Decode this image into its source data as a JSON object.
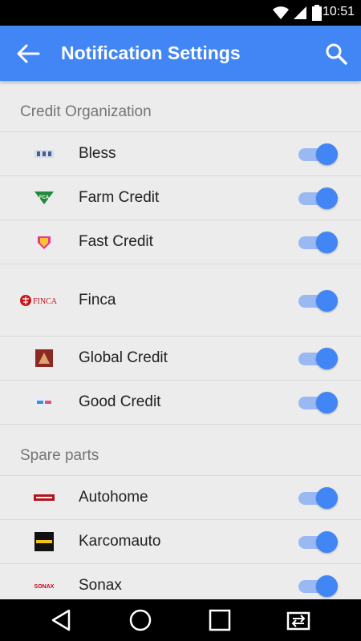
{
  "status_bar": {
    "time": "10:51",
    "icons": [
      "wifi-icon",
      "signal-icon",
      "battery-icon"
    ]
  },
  "app_bar": {
    "title": "Notification Settings",
    "back_icon": "back-arrow-icon",
    "search_icon": "search-icon"
  },
  "sections": [
    {
      "title": "Credit Organization",
      "items": [
        {
          "label": "Bless",
          "logo_text": "",
          "enabled": true
        },
        {
          "label": "Farm Credit",
          "logo_text": "FCA",
          "enabled": true
        },
        {
          "label": "Fast Credit",
          "logo_text": "",
          "enabled": true
        },
        {
          "label": "Finca",
          "logo_text": "FINCA",
          "enabled": true
        },
        {
          "label": "Global Credit",
          "logo_text": "",
          "enabled": true
        },
        {
          "label": "Good Credit",
          "logo_text": "",
          "enabled": true
        }
      ]
    },
    {
      "title": "Spare parts",
      "items": [
        {
          "label": "Autohome",
          "logo_text": "",
          "enabled": true
        },
        {
          "label": "Karcomauto",
          "logo_text": "",
          "enabled": true
        },
        {
          "label": "Sonax",
          "logo_text": "SONAX",
          "enabled": true
        }
      ]
    }
  ],
  "nav_bar": {
    "icons": [
      "back-triangle-icon",
      "home-circle-icon",
      "recents-square-icon",
      "switch-app-icon"
    ]
  },
  "colors": {
    "accent": "#4285f4",
    "toggle_track": "#9ab9f2",
    "background": "#ececec",
    "section_header_text": "#757575"
  }
}
